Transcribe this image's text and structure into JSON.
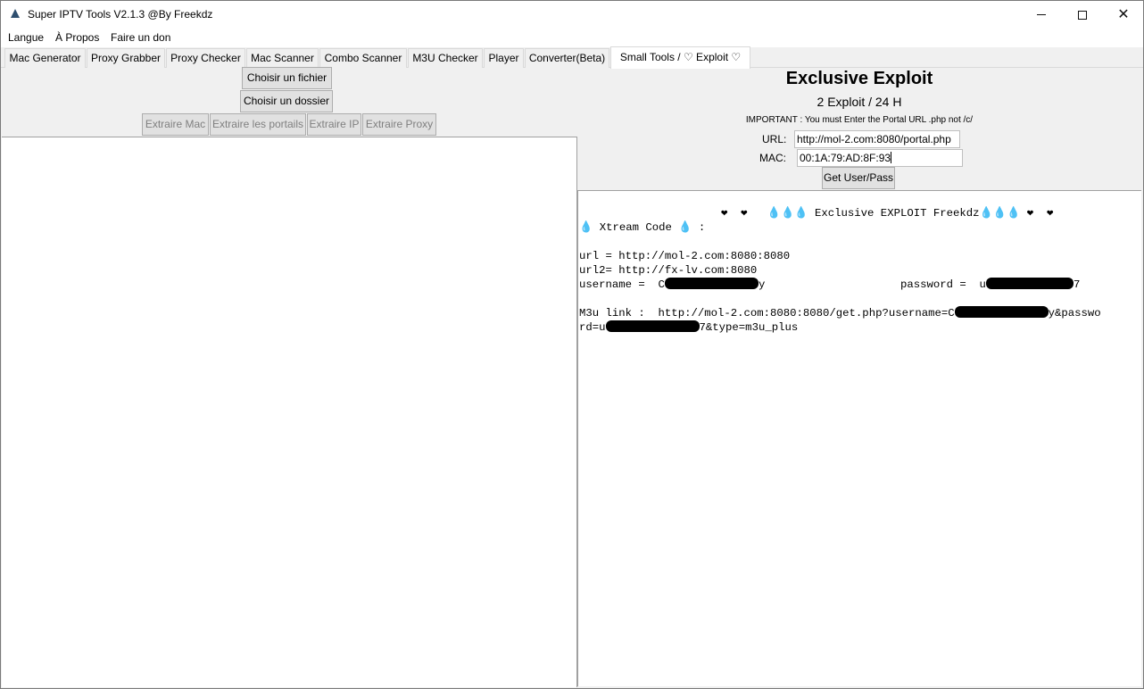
{
  "window": {
    "title": "Super IPTV Tools V2.1.3 @By Freekdz",
    "controls": {
      "minimize_icon": "minimize-icon",
      "maximize_icon": "maximize-icon",
      "close_icon": "close-icon",
      "close_glyph": "✕"
    }
  },
  "menu": {
    "langue": "Langue",
    "apropos": "À Propos",
    "don": "Faire un don"
  },
  "tabs": [
    {
      "label": "Mac Generator"
    },
    {
      "label": "Proxy Grabber"
    },
    {
      "label": "Proxy Checker"
    },
    {
      "label": "Mac Scanner"
    },
    {
      "label": "Combo Scanner"
    },
    {
      "label": "M3U Checker"
    },
    {
      "label": "Player"
    },
    {
      "label": "Converter(Beta)"
    },
    {
      "label": "Small Tools / ♡ Exploit ♡",
      "active": true
    }
  ],
  "left": {
    "choose_file": "Choisir un fichier",
    "choose_folder": "Choisir un dossier",
    "extract_mac": "Extraire Mac",
    "extract_portals": "Extraire les portails",
    "extract_ip": "Extraire IP",
    "extract_proxy": "Extraire Proxy"
  },
  "exploit": {
    "title": "Exclusive Exploit",
    "subtitle": "2 Exploit / 24 H",
    "important": "IMPORTANT : You must Enter the Portal URL .php not /c/",
    "url_label": "URL:",
    "url_value": "http://mol-2.com:8080/portal.php",
    "mac_label": "MAC:",
    "mac_value": "00:1A:79:AD:8F:93",
    "button": "Get User/Pass"
  },
  "output": {
    "header": "❤  ❤   💧💧💧 Exclusive EXPLOIT Freekdz💧💧💧 ❤  ❤",
    "xtream": "💧 Xtream Code 💧 :",
    "url": "url = http://mol-2.com:8080:8080",
    "url2": "url2= http://fx-lv.com:8080",
    "username_prefix": "username =  C",
    "username_suffix": "y",
    "password_prefix": "password =  u",
    "password_suffix": "7",
    "m3u_prefix": "M3u link :  http://mol-2.com:8080:8080/get.php?username=C",
    "m3u_mid": "y&passwo",
    "m3u_line2_prefix": "rd=u",
    "m3u_line2_suffix": "7&type=m3u_plus"
  },
  "colors": {
    "window_bg": "#f0f0f0",
    "button_bg": "#e1e1e1",
    "disabled_text": "#7f7f7f",
    "redaction": "#000000"
  }
}
